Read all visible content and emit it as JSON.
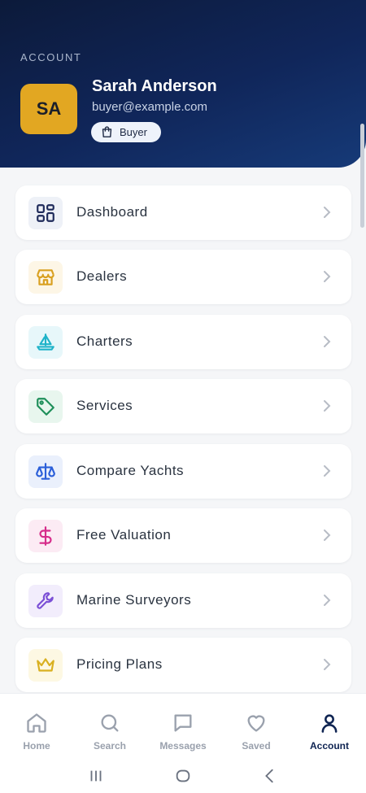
{
  "header": {
    "section_label": "ACCOUNT",
    "avatar_initials": "SA",
    "name": "Sarah Anderson",
    "email": "buyer@example.com",
    "role_badge": "Buyer"
  },
  "menu": [
    {
      "label": "Dashboard",
      "icon": "dashboard-grid-icon",
      "icon_color": "#1e2a5a",
      "icon_bg": "#eef1f7"
    },
    {
      "label": "Dealers",
      "icon": "store-icon",
      "icon_color": "#d9a020",
      "icon_bg": "#fdf6e6"
    },
    {
      "label": "Charters",
      "icon": "sailboat-icon",
      "icon_color": "#1fb3c9",
      "icon_bg": "#e7f7fa"
    },
    {
      "label": "Services",
      "icon": "tag-icon",
      "icon_color": "#1f8f5a",
      "icon_bg": "#e8f6ee"
    },
    {
      "label": "Compare Yachts",
      "icon": "scale-icon",
      "icon_color": "#2b5fd9",
      "icon_bg": "#eaf0fc"
    },
    {
      "label": "Free Valuation",
      "icon": "dollar-icon",
      "icon_color": "#d62b8a",
      "icon_bg": "#fcebf4"
    },
    {
      "label": "Marine Surveyors",
      "icon": "wrench-icon",
      "icon_color": "#7b4fd6",
      "icon_bg": "#f2edfc"
    },
    {
      "label": "Pricing Plans",
      "icon": "crown-icon",
      "icon_color": "#d9b020",
      "icon_bg": "#fdf8e3"
    }
  ],
  "bottom_nav": [
    {
      "label": "Home",
      "icon": "home-icon",
      "active": false
    },
    {
      "label": "Search",
      "icon": "search-icon",
      "active": false
    },
    {
      "label": "Messages",
      "icon": "chat-icon",
      "active": false
    },
    {
      "label": "Saved",
      "icon": "heart-icon",
      "active": false
    },
    {
      "label": "Account",
      "icon": "user-icon",
      "active": true
    }
  ],
  "colors": {
    "header_gradient_start": "#0c1a3a",
    "header_gradient_end": "#163a78",
    "avatar_bg": "#e2a722",
    "nav_active": "#0f2452",
    "nav_inactive": "#9aa1ad"
  }
}
